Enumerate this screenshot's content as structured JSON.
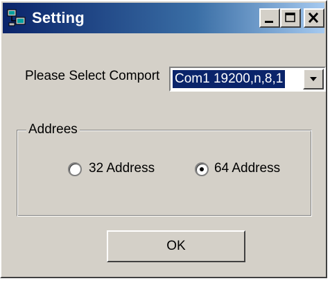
{
  "window": {
    "title": "Setting"
  },
  "titlebar": {
    "icons": [
      "app-icon",
      "minimize-icon",
      "maximize-icon",
      "close-icon"
    ]
  },
  "comport": {
    "label": "Please Select Comport",
    "selected": "Com1 19200,n,8,1"
  },
  "address_group": {
    "legend": "Addrees",
    "options": [
      {
        "label": "32 Address",
        "checked": false
      },
      {
        "label": "64 Address",
        "checked": true
      }
    ]
  },
  "ok_button": {
    "label": "OK"
  },
  "colors": {
    "titlebar_start": "#0a246a",
    "titlebar_end": "#a6caf0",
    "dialog_bg": "#d4d0c8",
    "selection": "#0a246a"
  }
}
